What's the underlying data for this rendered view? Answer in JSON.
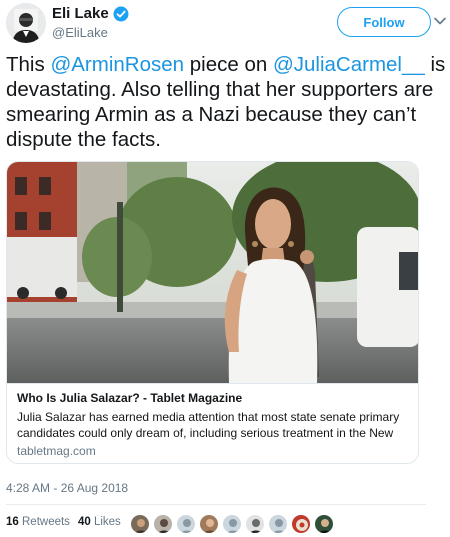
{
  "author": {
    "display_name": "Eli Lake",
    "handle": "@EliLake",
    "verified_icon": "verified-badge-icon",
    "avatar_icon": "avatar-icon"
  },
  "actions": {
    "follow_label": "Follow",
    "more_icon": "chevron-down-icon"
  },
  "tweet": {
    "part1": "This ",
    "mention1": "@ArminRosen",
    "part2": " piece on ",
    "mention2": "@JuliaCarmel__",
    "part3": " is devastating. Also telling that her supporters are smearing Armin as a Nazi because they can’t dispute the facts."
  },
  "card": {
    "image_icon": "card-photo",
    "title": "Who Is Julia Salazar? - Tablet Magazine",
    "description": "Julia Salazar has earned media attention that most state senate primary candidates could only dream of, including serious treatment in the New Yorker, and friendly p...",
    "domain": "tabletmag.com"
  },
  "meta": {
    "timestamp": "4:28 AM - 26 Aug 2018"
  },
  "stats": {
    "retweets_count": "16",
    "retweets_label": "Retweets",
    "likes_count": "40",
    "likes_label": "Likes",
    "liker_avatar_count": 9
  },
  "colors": {
    "accent": "#1da1f2",
    "mention": "#1b95e0",
    "muted": "#657786",
    "text": "#14171a"
  }
}
